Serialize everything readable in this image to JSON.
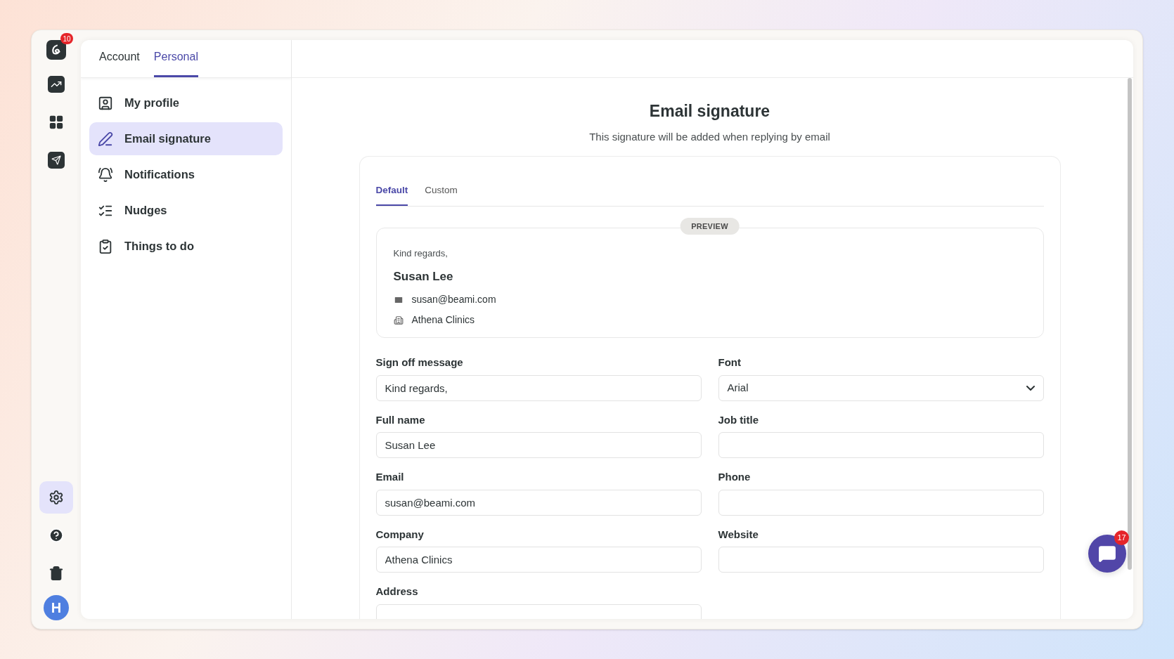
{
  "rail": {
    "logo_badge": "10",
    "items": [
      {
        "kind": "chart",
        "selected": false
      },
      {
        "kind": "apps",
        "selected": false
      },
      {
        "kind": "send",
        "selected": false
      }
    ],
    "bottom_items": [
      {
        "kind": "settings",
        "selected": true
      },
      {
        "kind": "help",
        "selected": false
      },
      {
        "kind": "trash",
        "selected": false
      }
    ],
    "avatar": "H"
  },
  "top_tabs": [
    {
      "label": "Account",
      "selected": false
    },
    {
      "label": "Personal",
      "selected": true
    }
  ],
  "sidebar": {
    "items": [
      {
        "kind": "profile",
        "label": "My profile",
        "selected": false
      },
      {
        "kind": "signature",
        "label": "Email signature",
        "selected": true
      },
      {
        "kind": "bell",
        "label": "Notifications",
        "selected": false
      },
      {
        "kind": "list",
        "label": "Nudges",
        "selected": false
      },
      {
        "kind": "todo",
        "label": "Things to do",
        "selected": false
      }
    ]
  },
  "page": {
    "title": "Email signature",
    "subtitle": "This signature will be added when replying by email"
  },
  "signature_tabs": [
    {
      "label": "Default",
      "selected": true
    },
    {
      "label": "Custom",
      "selected": false
    }
  ],
  "preview": {
    "badge": "PREVIEW",
    "greeting": "Kind regards,",
    "name": "Susan Lee",
    "email": "susan@beami.com",
    "company": "Athena Clinics"
  },
  "fields": [
    {
      "kind": "text",
      "label": "Sign off message",
      "value": "Kind regards,"
    },
    {
      "kind": "select",
      "label": "Font",
      "value": "Arial"
    },
    {
      "kind": "text",
      "label": "Full name",
      "value": "Susan Lee"
    },
    {
      "kind": "text",
      "label": "Job title"
    },
    {
      "kind": "text",
      "label": "Email",
      "value": "susan@beami.com"
    },
    {
      "kind": "text",
      "label": "Phone"
    },
    {
      "kind": "text",
      "label": "Company",
      "value": "Athena Clinics"
    },
    {
      "kind": "text",
      "label": "Website"
    },
    {
      "kind": "text",
      "label": "Address"
    }
  ],
  "chat": {
    "badge": "17"
  }
}
